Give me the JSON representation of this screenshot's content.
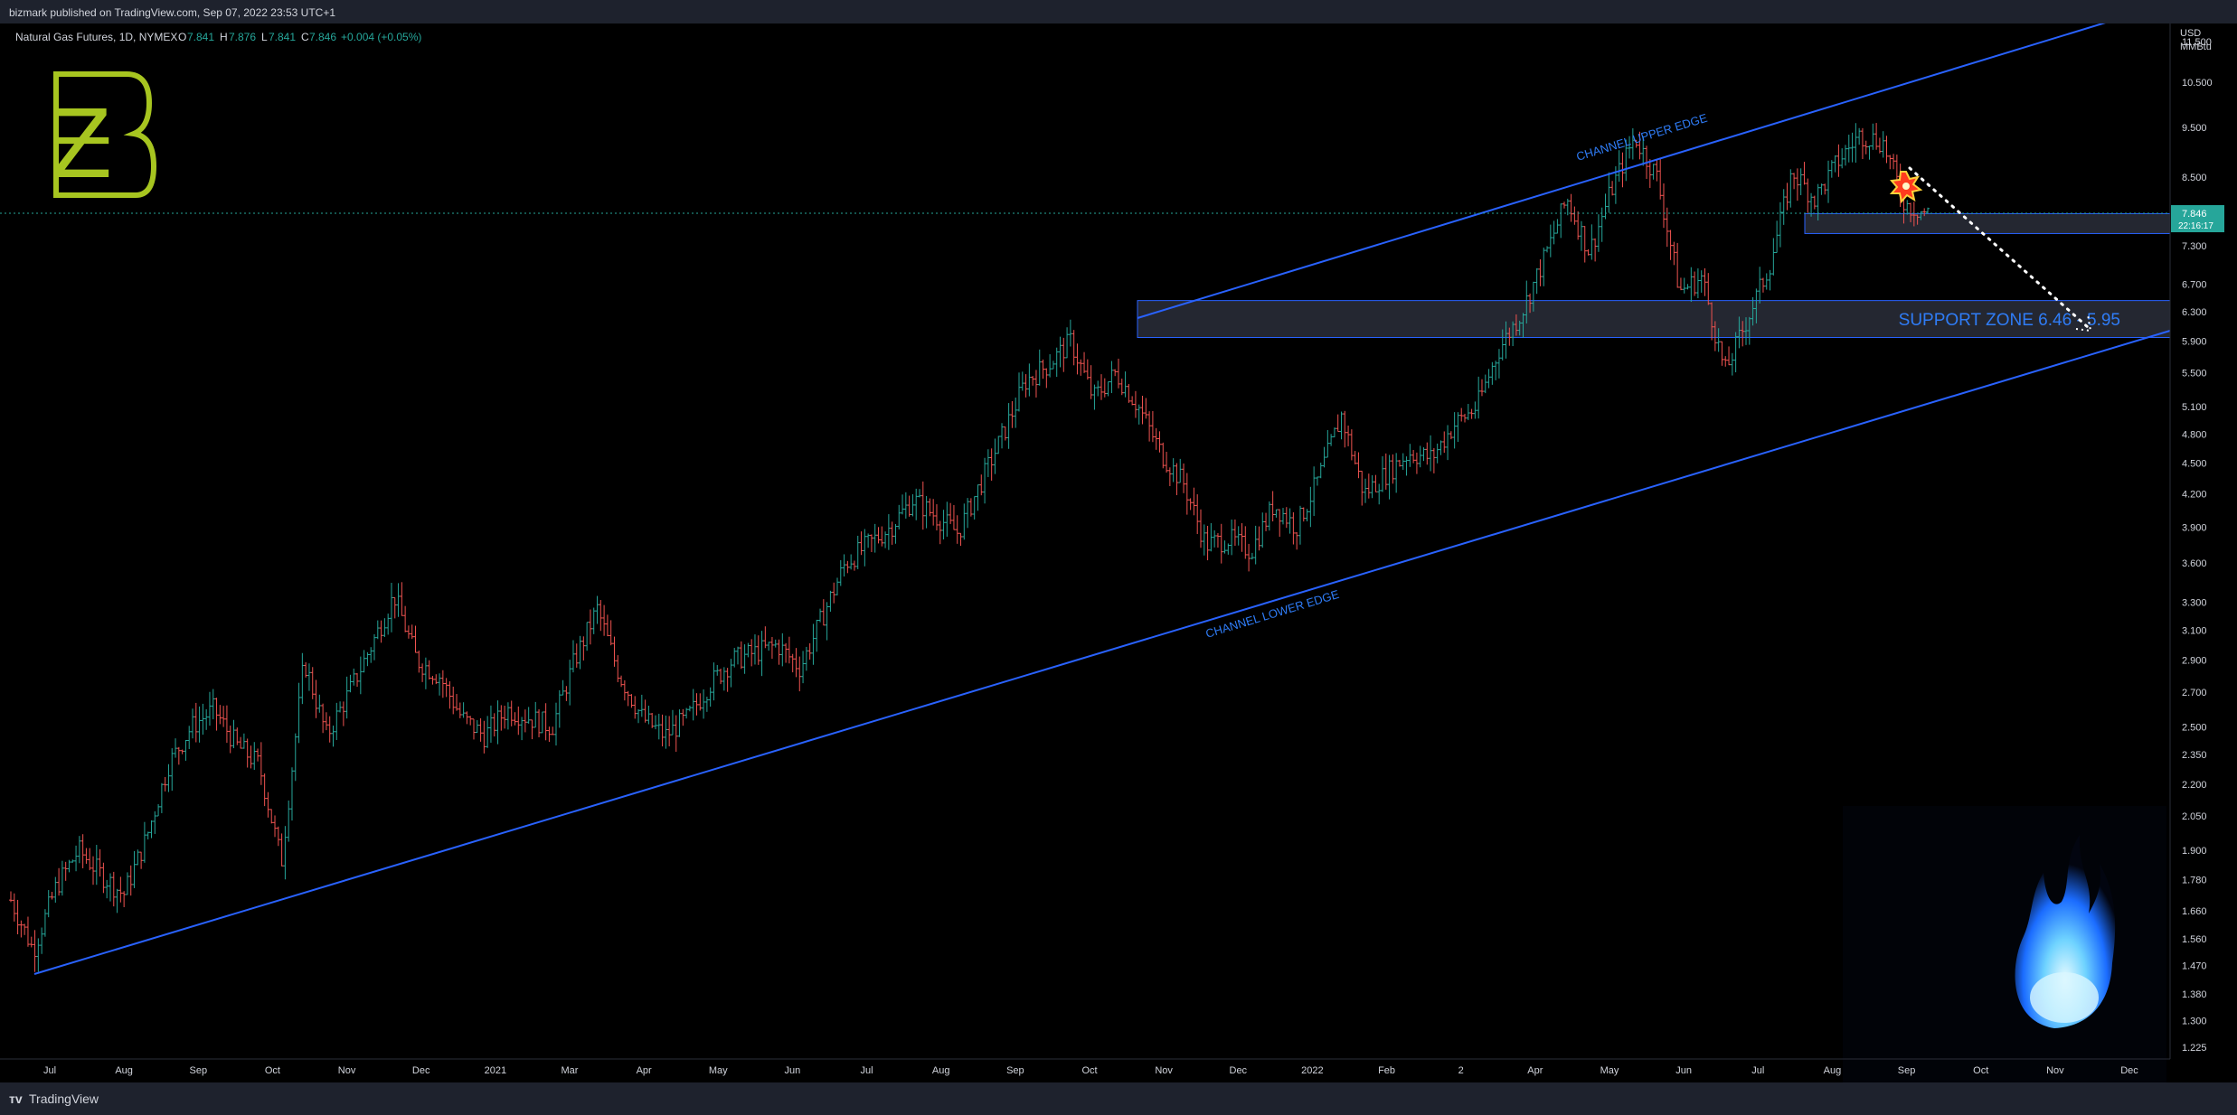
{
  "header": {
    "published": "bizmark published on TradingView.com, Sep 07, 2022 23:53 UTC+1"
  },
  "footer": {
    "brand": "TradingView"
  },
  "symbol": {
    "name": "Natural Gas Futures, 1D, NYMEX",
    "open_label": "O",
    "open": "7.841",
    "high_label": "H",
    "high": "7.876",
    "low_label": "L",
    "low": "7.841",
    "close_label": "C",
    "close": "7.846",
    "change": "+0.004 (+0.05%)"
  },
  "colors": {
    "up": "#26a69a",
    "down": "#ef5350",
    "channel": "#2962ff",
    "logo": "#a7c520",
    "price_tag": "#26a69a"
  },
  "price_axis": {
    "unit_line1": "USD",
    "unit_line2": "MMBtu",
    "ticks": [
      "11.500",
      "10.500",
      "9.500",
      "8.500",
      "7.846",
      "7.300",
      "6.700",
      "6.300",
      "5.900",
      "5.500",
      "5.100",
      "4.800",
      "4.500",
      "4.200",
      "3.900",
      "3.600",
      "3.300",
      "3.100",
      "2.900",
      "2.700",
      "2.500",
      "2.350",
      "2.200",
      "2.050",
      "1.900",
      "1.780",
      "1.660",
      "1.560",
      "1.470",
      "1.380",
      "1.300",
      "1.225"
    ],
    "countdown": "22:16:17"
  },
  "annotations": {
    "support_zone": "SUPPORT ZONE 6.46 - 5.95",
    "upper_edge": "CHANNEL UPPER EDGE",
    "lower_edge": "CHANNEL LOWER EDGE"
  },
  "logo_glyph": "Ƶ",
  "chart_data": {
    "type": "line",
    "title": "Natural Gas Futures, 1D, NYMEX",
    "x_ticks": [
      "Jul",
      "Aug",
      "Sep",
      "Oct",
      "Nov",
      "Dec",
      "2021",
      "Mar",
      "Apr",
      "May",
      "Jun",
      "Jul",
      "Aug",
      "Sep",
      "Oct",
      "Nov",
      "Dec",
      "2022",
      "Feb",
      "2",
      "Apr",
      "May",
      "Jun",
      "Jul",
      "Aug",
      "Sep",
      "Oct",
      "Nov",
      "Dec"
    ],
    "y_scale": "log",
    "ylim": [
      1.225,
      11.5
    ],
    "series": [
      {
        "values": [
          1.7,
          1.52,
          1.75,
          1.9,
          1.8,
          1.72,
          1.95,
          2.3,
          2.5,
          2.6,
          2.4,
          2.3,
          1.85,
          2.9,
          2.45,
          2.7,
          3.0,
          3.35,
          2.9,
          2.8,
          2.55,
          2.45,
          2.6,
          2.55,
          2.5,
          2.9,
          3.25,
          2.8,
          2.55,
          2.45,
          2.55,
          2.75,
          2.9,
          2.95,
          3.0,
          2.85,
          3.2,
          3.6,
          3.75,
          3.9,
          4.15,
          4.0,
          3.85,
          4.3,
          4.8,
          5.4,
          5.6,
          5.9,
          5.2,
          5.5,
          5.1,
          4.6,
          4.3,
          3.75,
          3.8,
          3.7,
          4.1,
          3.9,
          4.35,
          5.0,
          4.2,
          4.4,
          4.6,
          4.55,
          4.9,
          5.1,
          5.8,
          6.3,
          7.1,
          8.1,
          7.2,
          8.3,
          9.3,
          8.5,
          6.6,
          6.8,
          5.5,
          6.2,
          7.0,
          8.6,
          8.1,
          8.8,
          9.35,
          9.2,
          8.0,
          7.846
        ]
      }
    ],
    "overlays": {
      "support_zone": [
        6.46,
        5.95
      ],
      "current_range": [
        7.84,
        7.5
      ]
    }
  }
}
